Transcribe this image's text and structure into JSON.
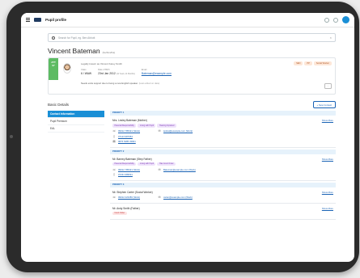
{
  "app": {
    "title": "Pupil profile"
  },
  "search": {
    "placeholder": "Search for Pupil, eg. Ben Abbott",
    "clear_icon": "close-icon"
  },
  "pupil": {
    "name": "Vincent Bateman",
    "pronoun": "(he/him/his)",
    "attendance_label": "ATT",
    "attendance_value": "97",
    "lead": "Legally known as Vincent Karey Smith",
    "badges": [
      "SEN",
      "PP",
      "Social Worker"
    ],
    "fields": [
      {
        "label": "Class",
        "value": "6 / WAW",
        "extra": ""
      },
      {
        "label": "Date of Birth",
        "value": "23rd Jan 2012",
        "extra": "(11 Years, 11 Months)"
      },
      {
        "label": "Email",
        "value": "Bateman@example.com",
        "extra": ""
      }
    ],
    "note": "Needs extra support due to being a new English speaker.",
    "note_muted": "(Last edited on date)",
    "more_label": "..."
  },
  "details": {
    "section_title": "Basic Details",
    "new_contact_label": "+ New Contact",
    "sidebar": [
      {
        "label": "Contact Information",
        "active": true
      },
      {
        "label": "Pupil Premium",
        "active": false
      },
      {
        "label": "EAL",
        "active": false
      }
    ],
    "show_more_label": "Show More",
    "groups": [
      {
        "priority": "PRIORITY 1",
        "contacts": [
          {
            "name": "Mrs. Lesley Bateman (Mother)",
            "tags": [
              {
                "text": "Parental Responsibility",
                "tone": "purple"
              },
              {
                "text": "Living with Pupil",
                "tone": "purple"
              },
              {
                "text": "Hearing Impaired",
                "tone": "purple"
              }
            ],
            "rows": [
              {
                "icon": "phone-icon",
                "glyph": "☏",
                "text": "09012 785321 (Work)",
                "icon2": "email-icon",
                "glyph2": "✉",
                "text2": "lesbat@example.com (Work)"
              },
              {
                "icon": "mobile-icon",
                "glyph": "▯",
                "text": "07123 987654",
                "icon2": "",
                "glyph2": "",
                "text2": ""
              },
              {
                "icon": "fax-icon",
                "glyph": "▤",
                "text": "0876 5485 33901",
                "icon2": "",
                "glyph2": "",
                "text2": ""
              }
            ]
          }
        ]
      },
      {
        "priority": "PRIORITY 2",
        "contacts": [
          {
            "name": "Mr. Barney Bateman (Step Father)",
            "tags": [
              {
                "text": "Parental Responsibility",
                "tone": "purple"
              },
              {
                "text": "Living with Pupil",
                "tone": "purple"
              },
              {
                "text": "Has Court Order",
                "tone": "purple"
              }
            ],
            "rows": [
              {
                "icon": "phone-icon",
                "glyph": "☏",
                "text": "09012 785321 (Work)",
                "icon2": "email-icon",
                "glyph2": "✉",
                "text2": "Bateman@example.com (Work)"
              },
              {
                "icon": "mobile-icon",
                "glyph": "▯",
                "text": "07231 989531",
                "icon2": "",
                "glyph2": "",
                "text2": ""
              }
            ]
          }
        ]
      },
      {
        "priority": "PRIORITY 3",
        "contacts": [
          {
            "name": "Mr. Stephen Carter (Social Worker)",
            "tags": [],
            "rows": [
              {
                "icon": "phone-icon",
                "glyph": "☏",
                "text": "09012 223456 (Work)",
                "icon2": "email-icon",
                "glyph2": "✉",
                "text2": "carter@example.com (Work)"
              }
            ]
          },
          {
            "name": "Mr. Andy Smith (Father)",
            "tags": [
              {
                "text": "Court Order",
                "tone": "red"
              }
            ],
            "rows": []
          }
        ]
      }
    ]
  }
}
